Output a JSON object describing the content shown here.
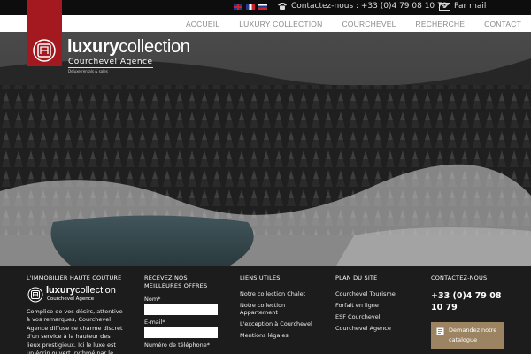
{
  "topbar": {
    "flags": [
      "uk-flag-icon",
      "fr-flag-icon",
      "ru-flag-icon"
    ],
    "contact_text": "Contactez-nous : +33 (0)4 79 08 10 79",
    "mail_text": "Par mail"
  },
  "nav": {
    "items": [
      "ACCUEIL",
      "LUXURY COLLECTION",
      "COURCHEVEL",
      "RECHERCHE",
      "CONTACT"
    ]
  },
  "logo": {
    "brand_bold": "luxury",
    "brand_light": "collection",
    "subtitle": "Courchevel Agence",
    "tagline": "Deluxe rentals & sales"
  },
  "colors": {
    "accent_red": "#a4191f",
    "cta_gold": "#9c8462",
    "footer_bg": "#1c1c1c"
  },
  "footer": {
    "col1": {
      "title": "L'IMMOBILIER HAUTE COUTURE",
      "brand_bold": "luxury",
      "brand_light": "collection",
      "subtitle": "Courchevel Agence",
      "about": "Complice de vos désirs, attentive à vos remarques, Courchevel Agence diffuse ce charme discret d'un service à la hauteur des lieux prestigieux. Ici le luxe est un écrin ouvert, rythmé par le plaisir"
    },
    "col2": {
      "title_line1": "RECEVEZ NOS",
      "title_line2": "MEILLEURES OFFRES",
      "name_label": "Nom*",
      "email_label": "E-mail*",
      "phone_label": "Numéro de téléphone*"
    },
    "col3": {
      "title": "LIENS UTILES",
      "links": [
        "Notre collection Chalet",
        "Notre collection Appartement",
        "L'exception à Courchevel",
        "Mentions légales"
      ]
    },
    "col4": {
      "title": "PLAN DU SITE",
      "links": [
        "Courchevel Tourisme",
        "Forfait en ligne",
        "ESF Courchevel",
        "Courchevel Agence"
      ]
    },
    "col5": {
      "title": "CONTACTEZ-NOUS",
      "phone": "+33 (0)4 79 08 10 79",
      "cta_label": "Demandez notre catalogue"
    }
  }
}
